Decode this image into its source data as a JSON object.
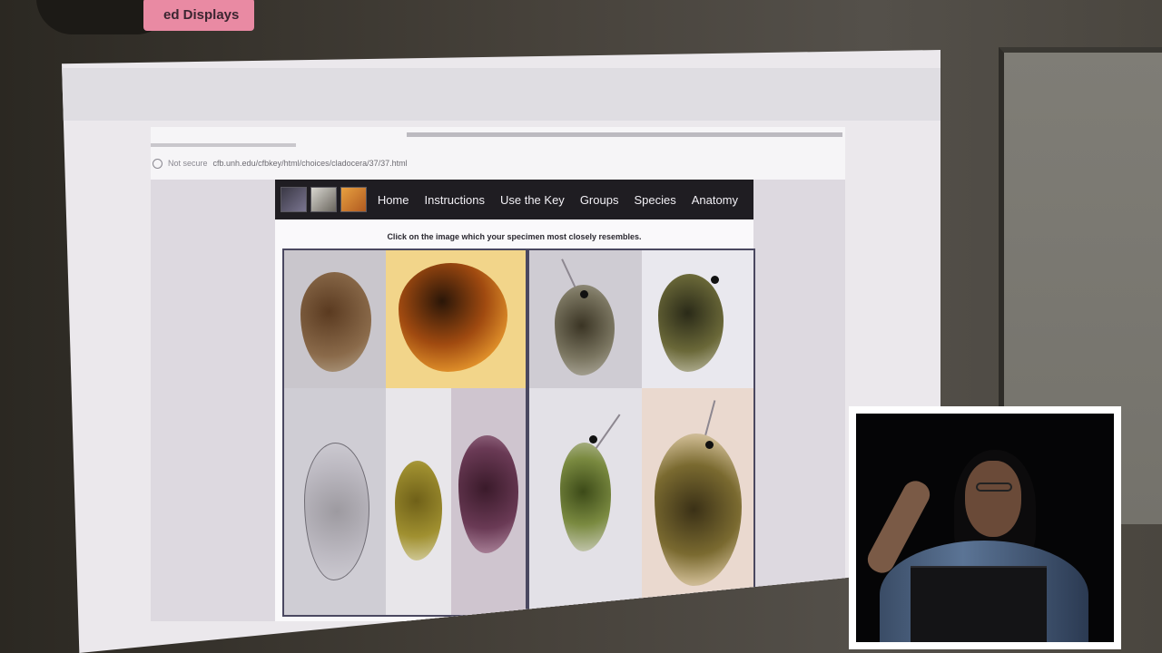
{
  "top_badge": {
    "label": "ed Displays"
  },
  "browser": {
    "security_label": "Not secure",
    "url": "cfb.unh.edu/cfbkey/html/choices/cladocera/37/37.html"
  },
  "site": {
    "nav_items": [
      "Home",
      "Instructions",
      "Use the Key",
      "Groups",
      "Species",
      "Anatomy"
    ],
    "instruction": "Click on the image which your specimen most closely resembles."
  },
  "icons": {
    "thumbs": [
      "daphnia-thumb-icon",
      "copepod-thumb-icon",
      "orange-specimen-thumb-icon"
    ]
  },
  "colors": {
    "nav_bg": "#1f1d22",
    "panel_border": "#4a4860",
    "badge_pink": "#e98aa3"
  }
}
